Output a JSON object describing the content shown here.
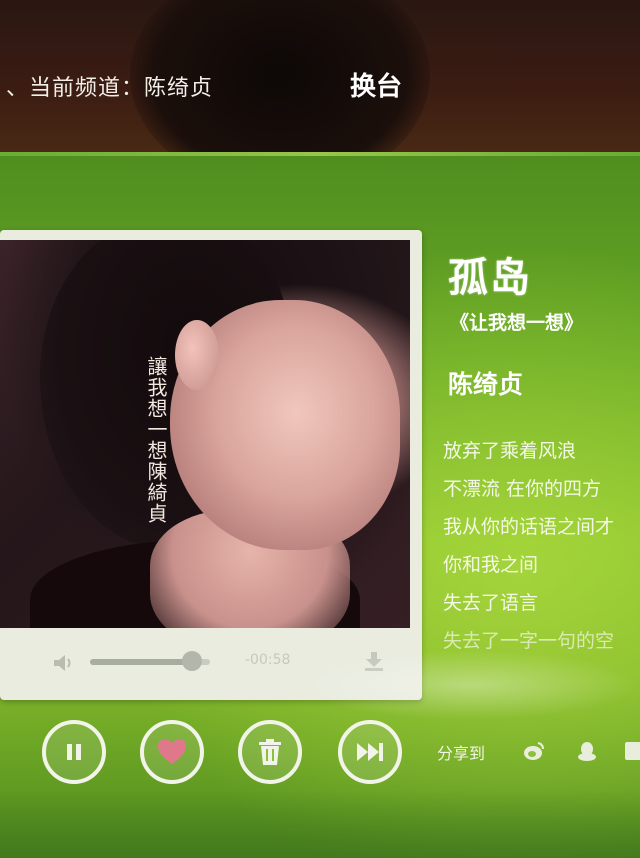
{
  "header": {
    "channel_label": "、当前频道：陈绮贞",
    "switch_button": "换台"
  },
  "song": {
    "title": "孤岛",
    "album": "《让我想一想》",
    "artist": "陈绮贞"
  },
  "cover": {
    "text": "讓我想一想陳綺貞"
  },
  "player": {
    "time": "-00:58",
    "volume_level": 0.85
  },
  "lyrics": [
    "放弃了乘着风浪",
    "不漂流 在你的四方",
    "我从你的话语之间才",
    "你和我之间",
    "失去了语言",
    "失去了一字一句的空"
  ],
  "share": {
    "label": "分享到"
  },
  "colors": {
    "accent_green": "#7fb52a",
    "heart_pink": "#e0788c"
  },
  "icons": {
    "pause": "pause-icon",
    "like": "heart-icon",
    "trash": "trash-icon",
    "next": "next-track-icon",
    "volume": "speaker-icon",
    "download": "download-icon",
    "weibo": "weibo-icon",
    "qq": "qq-icon",
    "renren": "renren-icon"
  }
}
